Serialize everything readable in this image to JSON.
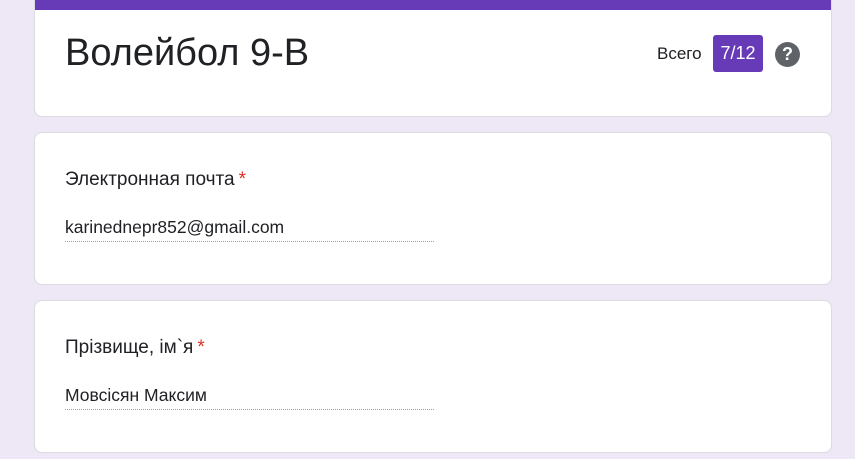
{
  "form": {
    "title": "Волейбол 9-В",
    "score_label": "Всего",
    "score_value": "7/12",
    "accent_color": "#673ab7",
    "help_icon": "help-icon"
  },
  "questions": [
    {
      "title": "Электронная почта",
      "required_mark": "*",
      "answer": "karinednepr852@gmail.com"
    },
    {
      "title": "Прізвище, ім`я",
      "required_mark": "*",
      "answer": "Мовсісян Максим"
    }
  ]
}
